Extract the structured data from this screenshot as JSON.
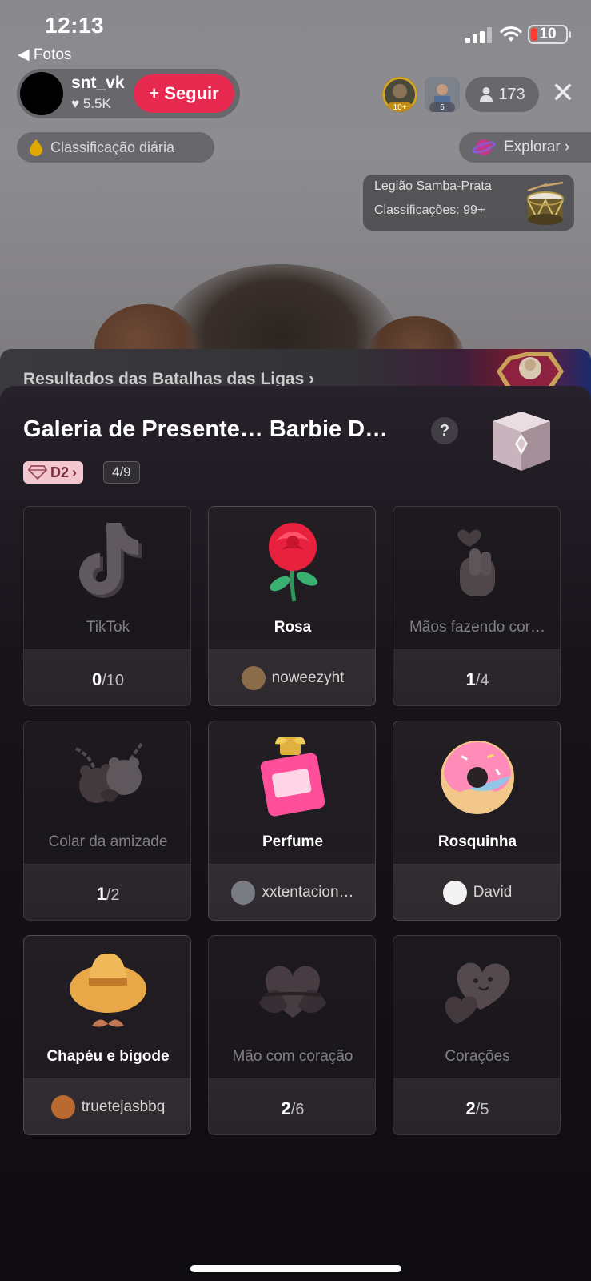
{
  "status_bar": {
    "time": "12:13",
    "back_label": "◀ Fotos",
    "battery": "10"
  },
  "host": {
    "name": "snt_vk",
    "likes": "♥ 5.5K",
    "follow_label": "+ Seguir"
  },
  "viewers": {
    "badge1": "10+",
    "badge2": "6",
    "count": "173"
  },
  "daily_ranking_label": "Classificação diária",
  "explore_label": "Explorar ›",
  "legion": {
    "name": "Legião Samba-Prata",
    "rankings": "Classificações: 99+"
  },
  "battle_results_label": "Resultados das Batalhas das Ligas ›",
  "gallery": {
    "title": "Galeria de Presente… Barbie D…",
    "help": "?",
    "tier": "D2",
    "tier_chevron": "›",
    "progress": "4/9",
    "gifts": [
      {
        "name": "TikTok",
        "collected": "0",
        "total": "/10",
        "lit": false,
        "icon": "tiktok-gift-icon"
      },
      {
        "name": "Rosa",
        "user": "noweezyht",
        "lit": true,
        "icon": "rose-gift-icon"
      },
      {
        "name": "Mãos fazendo cor…",
        "collected": "1",
        "total": "/4",
        "lit": false,
        "icon": "finger-heart-gift-icon"
      },
      {
        "name": "Colar da amizade",
        "collected": "1",
        "total": "/2",
        "lit": false,
        "icon": "friendship-necklace-gift-icon"
      },
      {
        "name": "Perfume",
        "user": "xxtentacion…",
        "lit": true,
        "icon": "perfume-gift-icon"
      },
      {
        "name": "Rosquinha",
        "user": "David",
        "lit": true,
        "icon": "donut-gift-icon"
      },
      {
        "name": "Chapéu e bigode",
        "user": "truetejasbbq",
        "lit": true,
        "icon": "hat-mustache-gift-icon"
      },
      {
        "name": "Mão com coração",
        "collected": "2",
        "total": "/6",
        "lit": false,
        "icon": "hand-heart-gift-icon"
      },
      {
        "name": "Corações",
        "collected": "2",
        "total": "/5",
        "lit": false,
        "icon": "hearts-gift-icon"
      }
    ]
  },
  "colors": {
    "follow": "#e8294f",
    "tier_bg": "#f2c7cf",
    "sheet_bg": "#17141a"
  }
}
